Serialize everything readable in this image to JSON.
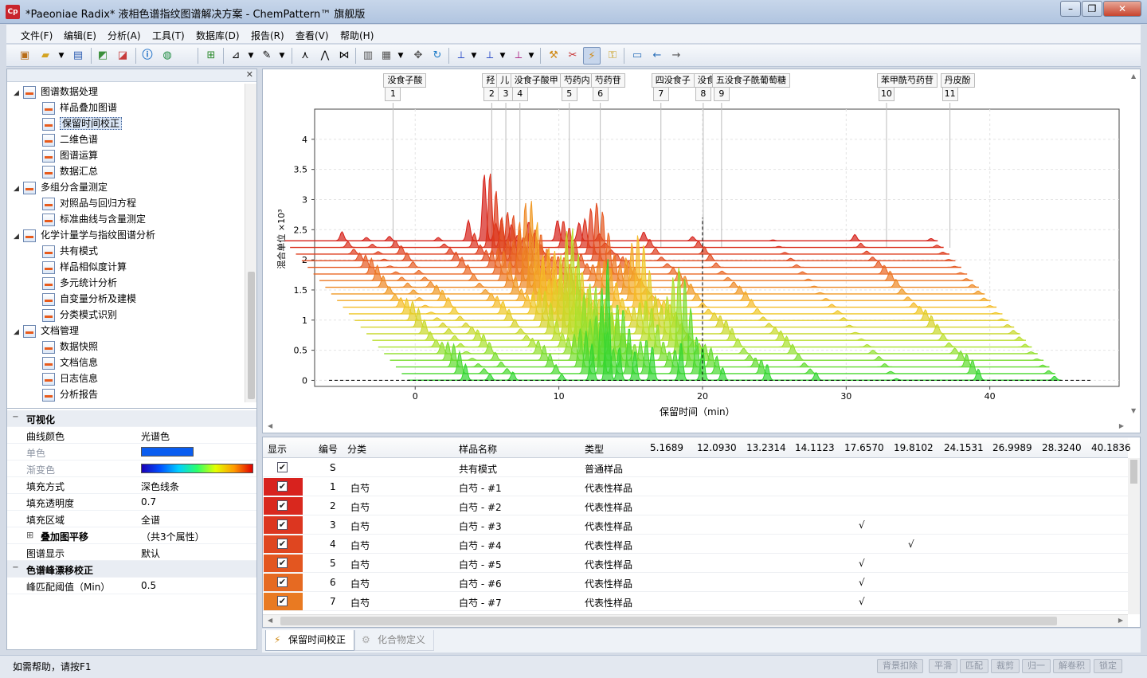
{
  "window": {
    "title": "*Paeoniae Radix* 液相色谱指纹图谱解决方案 - ChemPattern™ 旗舰版",
    "icon_text": "Cp"
  },
  "menu": [
    "文件(F)",
    "编辑(E)",
    "分析(A)",
    "工具(T)",
    "数据库(D)",
    "报告(R)",
    "查看(V)",
    "帮助(H)"
  ],
  "tree": [
    {
      "label": "图谱数据处理",
      "level": 0
    },
    {
      "label": "样品叠加图谱",
      "level": 1
    },
    {
      "label": "保留时间校正",
      "level": 1,
      "selected": true
    },
    {
      "label": "二维色谱",
      "level": 1
    },
    {
      "label": "图谱运算",
      "level": 1
    },
    {
      "label": "数据汇总",
      "level": 1
    },
    {
      "label": "多组分含量测定",
      "level": 0
    },
    {
      "label": "对照品与回归方程",
      "level": 1
    },
    {
      "label": "标准曲线与含量测定",
      "level": 1
    },
    {
      "label": "化学计量学与指纹图谱分析",
      "level": 0
    },
    {
      "label": "共有模式",
      "level": 1
    },
    {
      "label": "样品相似度计算",
      "level": 1
    },
    {
      "label": "多元统计分析",
      "level": 1
    },
    {
      "label": "自变量分析及建模",
      "level": 1
    },
    {
      "label": "分类模式识别",
      "level": 1
    },
    {
      "label": "文档管理",
      "level": 0
    },
    {
      "label": "数据快照",
      "level": 1
    },
    {
      "label": "文档信息",
      "level": 1
    },
    {
      "label": "日志信息",
      "level": 1
    },
    {
      "label": "分析报告",
      "level": 1
    }
  ],
  "properties": {
    "cat1": "可视化",
    "rows": [
      {
        "k": "曲线颜色",
        "v": "光谱色"
      },
      {
        "k": "单色",
        "v": "",
        "dim": true
      },
      {
        "k": "渐变色",
        "v": "",
        "dim": true
      },
      {
        "k": "填充方式",
        "v": "深色线条"
      },
      {
        "k": "填充透明度",
        "v": "0.7"
      },
      {
        "k": "填充区域",
        "v": "全谱"
      },
      {
        "k": "叠加图平移",
        "v": "（共3个属性）",
        "bold": true
      },
      {
        "k": "图谱显示",
        "v": "默认"
      }
    ],
    "cat2": "色谱峰漂移校正",
    "rows2": [
      {
        "k": "峰匹配阈值（Min）",
        "v": "0.5"
      }
    ],
    "mono_color": "#0a5df0"
  },
  "chart_data": {
    "type": "line",
    "xlabel": "保留时间（min）",
    "ylabel": "混合单位 ×10³",
    "xlim": [
      -7,
      49
    ],
    "ylim": [
      -0.1,
      4.5
    ],
    "x_ticks": [
      0,
      10,
      20,
      30,
      40
    ],
    "y_ticks": [
      0,
      0.5,
      1,
      1.5,
      2,
      2.5,
      3,
      3.5,
      4
    ],
    "peak_labels": [
      {
        "num": "1",
        "name": "没食子酸",
        "x": -2
      },
      {
        "num": "2",
        "name": "羟",
        "x": 5
      },
      {
        "num": "3",
        "name": "儿",
        "x": 6
      },
      {
        "num": "4",
        "name": "没食子酸甲",
        "x": 7
      },
      {
        "num": "5",
        "name": "芍药内",
        "x": 10.5
      },
      {
        "num": "6",
        "name": "芍药苷",
        "x": 12.7
      },
      {
        "num": "7",
        "name": "四没食子",
        "x": 17
      },
      {
        "num": "8",
        "name": "没食",
        "x": 20
      },
      {
        "num": "9",
        "name": "五没食子酰葡萄糖",
        "x": 21.3
      },
      {
        "num": "10",
        "name": "苯甲酰芍药苷",
        "x": 33
      },
      {
        "num": "11",
        "name": "丹皮酚",
        "x": 37.5
      }
    ],
    "series_count": 22,
    "base_peaks": [
      {
        "t": 3.5,
        "h": 0.6
      },
      {
        "t": 5.2,
        "h": 0.15
      },
      {
        "t": 6.8,
        "h": 0.35
      },
      {
        "t": 10.2,
        "h": 0.4
      },
      {
        "t": 12.3,
        "h": 1.1
      },
      {
        "t": 13.4,
        "h": 3.3
      },
      {
        "t": 14.2,
        "h": 1.9
      },
      {
        "t": 15.3,
        "h": 1.6
      },
      {
        "t": 16.5,
        "h": 0.9
      },
      {
        "t": 18.5,
        "h": 1.2
      },
      {
        "t": 20.0,
        "h": 2.4
      },
      {
        "t": 21.4,
        "h": 0.5
      },
      {
        "t": 24.5,
        "h": 0.4
      },
      {
        "t": 27.9,
        "h": 0.3
      },
      {
        "t": 33.5,
        "h": 0.1
      },
      {
        "t": 39.2,
        "h": 0.35
      },
      {
        "t": 44.5,
        "h": 0.1
      }
    ]
  },
  "grid": {
    "headers": [
      "显示",
      "编号",
      "分类",
      "样品名称",
      "类型",
      "5.1689",
      "12.0930",
      "13.2314",
      "14.1123",
      "17.6570",
      "19.8102",
      "24.1531",
      "26.9989",
      "28.3240",
      "40.1836"
    ],
    "rows": [
      {
        "id": "S",
        "cls": "",
        "name": "共有模式",
        "type": "普通样品",
        "color": "#ffffff",
        "mark": ""
      },
      {
        "id": "1",
        "cls": "白芍",
        "name": "白芍 - #1",
        "type": "代表性样品",
        "color": "#d8221e",
        "mark": ""
      },
      {
        "id": "2",
        "cls": "白芍",
        "name": "白芍 - #2",
        "type": "代表性样品",
        "color": "#d9281e",
        "mark": ""
      },
      {
        "id": "3",
        "cls": "白芍",
        "name": "白芍 - #3",
        "type": "代表性样品",
        "color": "#dc3620",
        "mark": "17.6570"
      },
      {
        "id": "4",
        "cls": "白芍",
        "name": "白芍 - #4",
        "type": "代表性样品",
        "color": "#df4620",
        "mark": "19.8102"
      },
      {
        "id": "5",
        "cls": "白芍",
        "name": "白芍 - #5",
        "type": "代表性样品",
        "color": "#e35620",
        "mark": "17.6570"
      },
      {
        "id": "6",
        "cls": "白芍",
        "name": "白芍 - #6",
        "type": "代表性样品",
        "color": "#e66a22",
        "mark": "17.6570"
      },
      {
        "id": "7",
        "cls": "白芍",
        "name": "白芍 - #7",
        "type": "代表性样品",
        "color": "#e97a22",
        "mark": "17.6570"
      }
    ],
    "check_mark": "√",
    "checked_mark": "✔"
  },
  "tabs": [
    "保留时间校正",
    "化合物定义"
  ],
  "status": {
    "text": "如需帮助，请按F1",
    "buttons": [
      "背景扣除",
      "平滑",
      "匹配",
      "裁剪",
      "归一",
      "解卷积",
      "锁定"
    ]
  }
}
